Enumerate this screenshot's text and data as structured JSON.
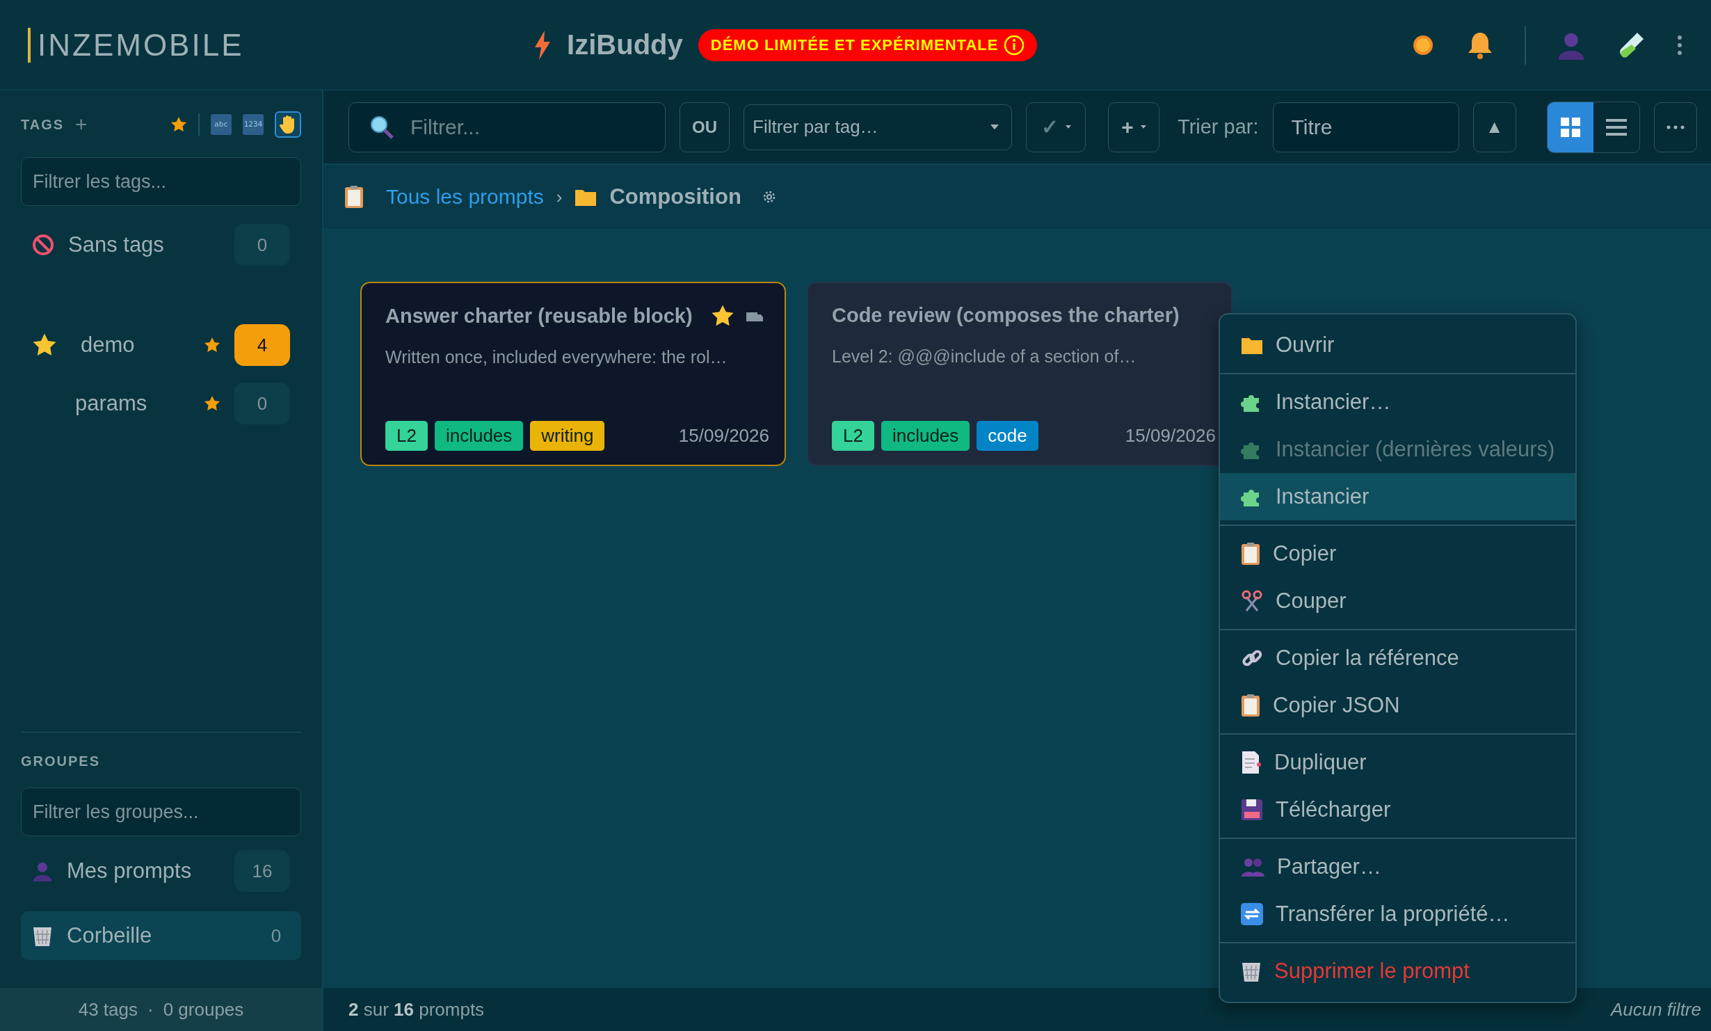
{
  "header": {
    "logo": "INZEMOBILE",
    "app_name": "IziBuddy",
    "demo_badge": "DÉMO LIMITÉE ET EXPÉRIMENTALE"
  },
  "sidebar": {
    "tags_title": "TAGS",
    "add_label": "+",
    "sort_buttons": [
      {
        "label": "abc",
        "selected": false
      },
      {
        "label": "1234",
        "selected": false
      }
    ],
    "hand_selected": true,
    "tag_filter_placeholder": "Filtrer les tags...",
    "tags": [
      {
        "kind": "untagged",
        "name": "Sans tags",
        "count": "0",
        "starred": false,
        "highlighted": false
      },
      {
        "kind": "starred",
        "name": "demo",
        "count": "4",
        "starred": true,
        "highlighted": true
      },
      {
        "kind": "plain",
        "name": "params",
        "count": "0",
        "starred": true,
        "highlighted": false
      }
    ],
    "groups_title": "GROUPES",
    "group_filter_placeholder": "Filtrer les groupes...",
    "groups": [
      {
        "kind": "user",
        "name": "Mes prompts",
        "count": "16",
        "selected": false
      },
      {
        "kind": "trash",
        "name": "Corbeille",
        "count": "0",
        "selected": true
      }
    ],
    "footer": [
      "43 tags",
      "·",
      "0 groupes"
    ]
  },
  "toolbar": {
    "search_placeholder": "Filtrer...",
    "or_button": "OU",
    "tag_filter_placeholder": "Filtrer par tag…",
    "check_label": "✓",
    "add_label": "+",
    "sort_label": "Trier par:",
    "sort_value": "Titre",
    "sort_direction": "▲",
    "views": [
      {
        "kind": "grid",
        "selected": true
      },
      {
        "kind": "list",
        "selected": false
      }
    ]
  },
  "breadcrumb": {
    "root": "Tous les prompts",
    "separator": "›",
    "current": "Composition"
  },
  "cards": [
    {
      "title": "Answer charter (reusable block)",
      "starred": true,
      "selected": true,
      "description": "Written once, included everywhere: the rol…",
      "date": "15/09/2026",
      "tags": [
        {
          "label": "L2",
          "color": "#34d399"
        },
        {
          "label": "includes",
          "color": "#10b981"
        },
        {
          "label": "writing",
          "color": "#eab308"
        }
      ]
    },
    {
      "title": "Code review (composes the charter)",
      "starred": false,
      "selected": false,
      "description": "Level 2: @@@include of a section of…",
      "date": "15/09/2026",
      "tags": [
        {
          "label": "L2",
          "color": "#34d399"
        },
        {
          "label": "includes",
          "color": "#10b981"
        },
        {
          "label": "code",
          "color": "#0284c7"
        }
      ]
    }
  ],
  "status_bar": {
    "count": "**2** sur **16** prompts",
    "filter": "Aucun filtre"
  },
  "context_menu": [
    [
      {
        "kind": "folder",
        "label": "Ouvrir",
        "disabled": false,
        "highlighted": false,
        "danger": false
      }
    ],
    [
      {
        "kind": "puzzle",
        "label": "Instancier…",
        "disabled": false,
        "highlighted": false,
        "danger": false
      },
      {
        "kind": "puzzle",
        "label": "Instancier (dernières valeurs)",
        "disabled": true,
        "highlighted": false,
        "danger": false
      },
      {
        "kind": "puzzle",
        "label": "Instancier",
        "disabled": false,
        "highlighted": true,
        "danger": false
      }
    ],
    [
      {
        "kind": "clipboard",
        "label": "Copier",
        "disabled": false,
        "highlighted": false,
        "danger": false
      },
      {
        "kind": "scissors",
        "label": "Couper",
        "disabled": false,
        "highlighted": false,
        "danger": false
      }
    ],
    [
      {
        "kind": "link",
        "label": "Copier la référence",
        "disabled": false,
        "highlighted": false,
        "danger": false
      },
      {
        "kind": "clipboard",
        "label": "Copier JSON",
        "disabled": false,
        "highlighted": false,
        "danger": false
      }
    ],
    [
      {
        "kind": "document",
        "label": "Dupliquer",
        "disabled": false,
        "highlighted": false,
        "danger": false
      },
      {
        "kind": "floppy",
        "label": "Télécharger",
        "disabled": false,
        "highlighted": false,
        "danger": false
      }
    ],
    [
      {
        "kind": "people",
        "label": "Partager…",
        "disabled": false,
        "highlighted": false,
        "danger": false
      },
      {
        "kind": "transfer",
        "label": "Transférer la propriété…",
        "disabled": false,
        "highlighted": false,
        "danger": false
      }
    ],
    [
      {
        "kind": "trash",
        "label": "Supprimer le prompt",
        "disabled": false,
        "highlighted": false,
        "danger": true
      }
    ]
  ]
}
